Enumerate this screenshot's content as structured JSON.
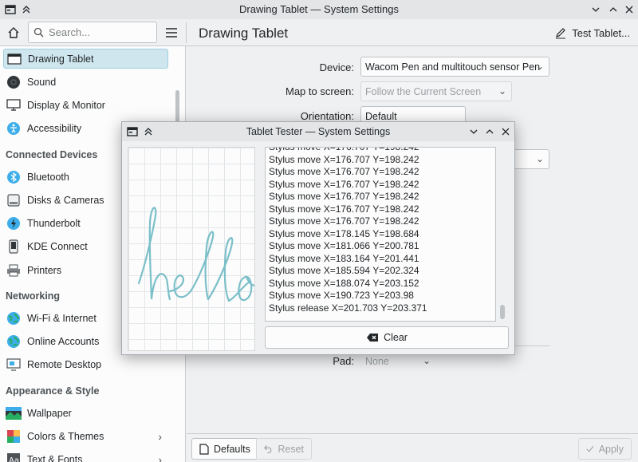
{
  "window": {
    "title": "Drawing Tablet — System Settings"
  },
  "toolbar": {
    "search_placeholder": "Search...",
    "page_title": "Drawing Tablet",
    "test_tablet_label": "Test Tablet..."
  },
  "sidebar": {
    "items": [
      {
        "label": "Drawing Tablet",
        "icon": "tablet-icon",
        "active": true
      },
      {
        "label": "Sound",
        "icon": "speaker-icon"
      },
      {
        "label": "Display & Monitor",
        "icon": "monitor-icon"
      },
      {
        "label": "Accessibility",
        "icon": "accessibility-icon"
      },
      {
        "label": "Bluetooth",
        "icon": "bluetooth-icon"
      },
      {
        "label": "Disks & Cameras",
        "icon": "disk-icon"
      },
      {
        "label": "Thunderbolt",
        "icon": "thunderbolt-icon"
      },
      {
        "label": "KDE Connect",
        "icon": "phone-icon"
      },
      {
        "label": "Printers",
        "icon": "printer-icon"
      },
      {
        "label": "Wi-Fi & Internet",
        "icon": "globe-icon"
      },
      {
        "label": "Online Accounts",
        "icon": "globe-icon"
      },
      {
        "label": "Remote Desktop",
        "icon": "remote-desktop-icon"
      },
      {
        "label": "Wallpaper",
        "icon": "wallpaper-icon"
      },
      {
        "label": "Colors & Themes",
        "icon": "palette-icon"
      },
      {
        "label": "Text & Fonts",
        "icon": "font-icon"
      }
    ],
    "headers": [
      "Connected Devices",
      "Networking",
      "Appearance & Style"
    ]
  },
  "form": {
    "device_label": "Device:",
    "device_value": "Wacom Pen and multitouch sensor Pen",
    "map_label": "Map to screen:",
    "map_value": "Follow the Current Screen",
    "orientation_label": "Orientation:",
    "orientation_value": "Default",
    "pad_label": "Pad:",
    "pad_value": "None"
  },
  "footer": {
    "defaults_label": "Defaults",
    "reset_label": "Reset",
    "apply_label": "Apply"
  },
  "dialog": {
    "title": "Tablet Tester — System Settings",
    "drawing_text": "hello",
    "log_lines": [
      "Stylus move X=176.707 Y=198.242",
      "Stylus move X=176.707 Y=198.242",
      "Stylus move X=176.707 Y=198.242",
      "Stylus move X=176.707 Y=198.242",
      "Stylus move X=176.707 Y=198.242",
      "Stylus move X=176.707 Y=198.242",
      "Stylus move X=176.707 Y=198.242",
      "Stylus move X=178.145 Y=198.684",
      "Stylus move X=181.066 Y=200.781",
      "Stylus move X=183.164 Y=201.441",
      "Stylus move X=185.594 Y=202.324",
      "Stylus move X=188.074 Y=203.152",
      "Stylus move X=190.723 Y=203.98",
      "Stylus release X=201.703 Y=203.371"
    ],
    "clear_label": "Clear"
  }
}
